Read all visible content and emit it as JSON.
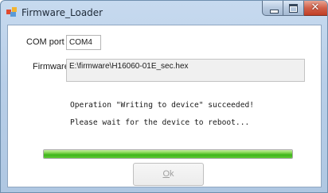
{
  "window": {
    "title": "Firmware_Loader",
    "controls": {
      "minimize_icon": "minimize-icon",
      "maximize_icon": "maximize-icon",
      "close_icon": "close-icon"
    },
    "app_icon": "app-icon"
  },
  "form": {
    "com_port_label": "COM port",
    "com_port_value": "COM4",
    "firmware_label": "Firmware",
    "firmware_path": "E:\\firmware\\H16060-01E_sec.hex"
  },
  "status": {
    "line1": "Operation \"Writing to device\" succeeded!",
    "line2": "Please wait for the device to reboot..."
  },
  "progress": {
    "percent": 100,
    "color": "#3db51b"
  },
  "buttons": {
    "ok_rest": "k",
    "ok_mnemonic": "O",
    "ok_enabled": false
  }
}
